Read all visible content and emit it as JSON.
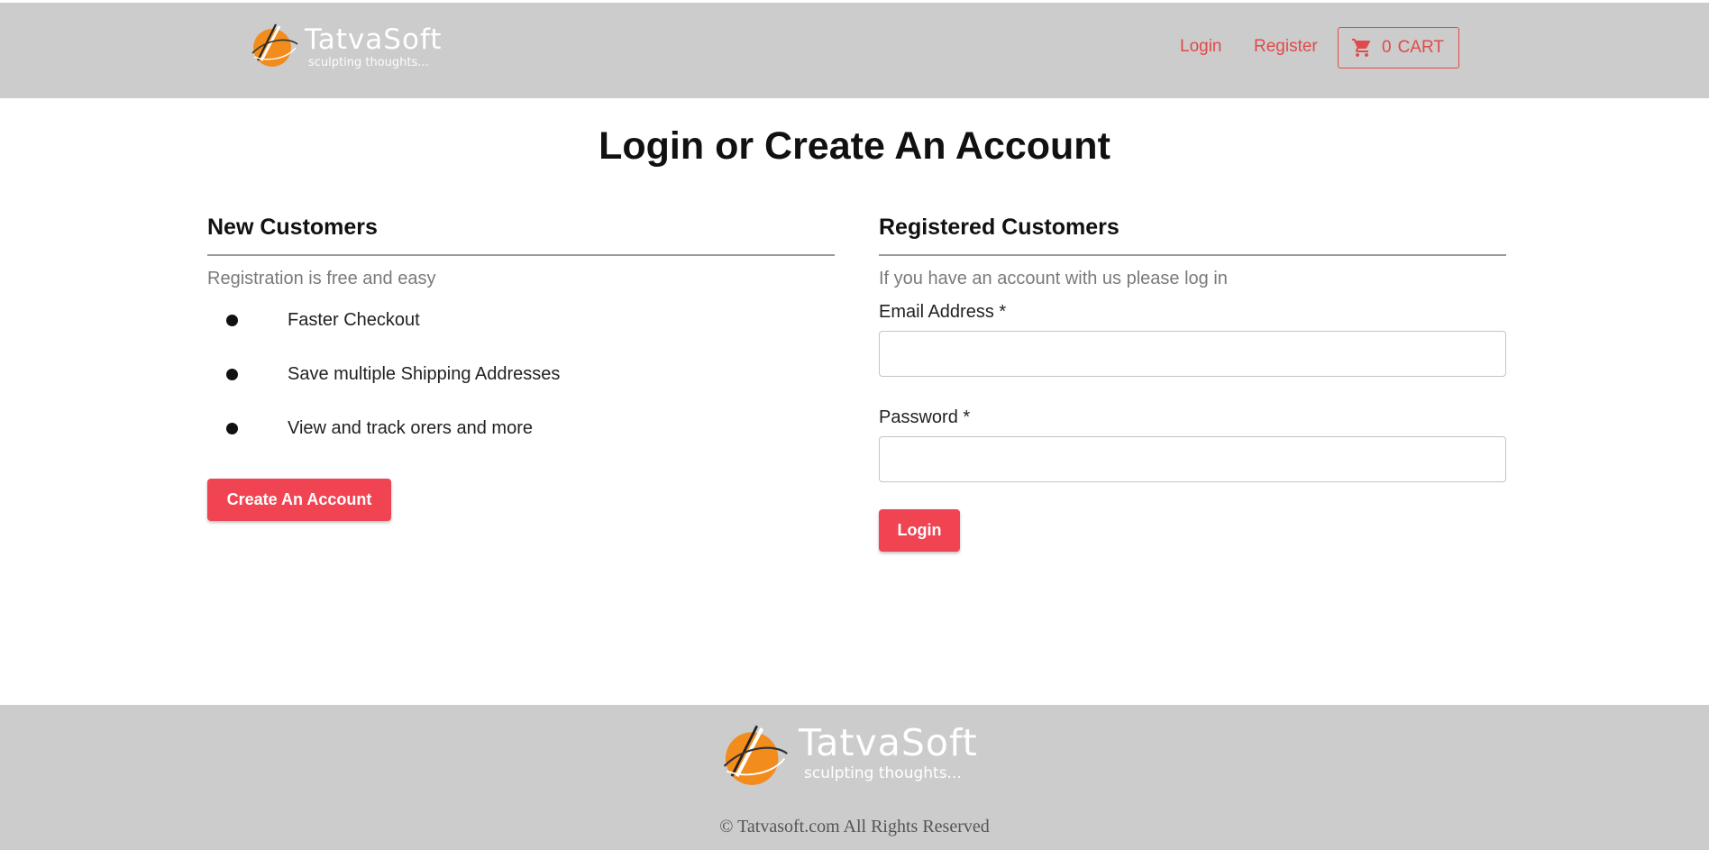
{
  "header": {
    "brand_name": "TatvaSoft",
    "brand_tagline": "sculpting thoughts...",
    "nav": {
      "login": "Login",
      "register": "Register"
    },
    "cart": {
      "count": "0",
      "label": "CART"
    }
  },
  "main": {
    "title": "Login or Create An Account",
    "new_customers": {
      "heading": "New Customers",
      "subtitle": "Registration is free and easy",
      "features": [
        "Faster Checkout",
        "Save multiple Shipping Addresses",
        "View and track orers and more"
      ],
      "button": "Create An Account"
    },
    "registered_customers": {
      "heading": "Registered Customers",
      "subtitle": "If you have an account with us please log in",
      "email_label": "Email Address *",
      "email_value": "",
      "password_label": "Password *",
      "password_value": "",
      "button": "Login"
    }
  },
  "footer": {
    "brand_name": "TatvaSoft",
    "brand_tagline": "sculpting thoughts...",
    "copyright": "© Tatvasoft.com All Rights Reserved"
  },
  "colors": {
    "accent": "#f04452",
    "link": "#e04a4a",
    "header_bg": "#cccccc",
    "logo_orange": "#f28c1c"
  },
  "icons": {
    "cart": "shopping-cart-icon",
    "logo": "tatvasoft-logo-icon"
  }
}
